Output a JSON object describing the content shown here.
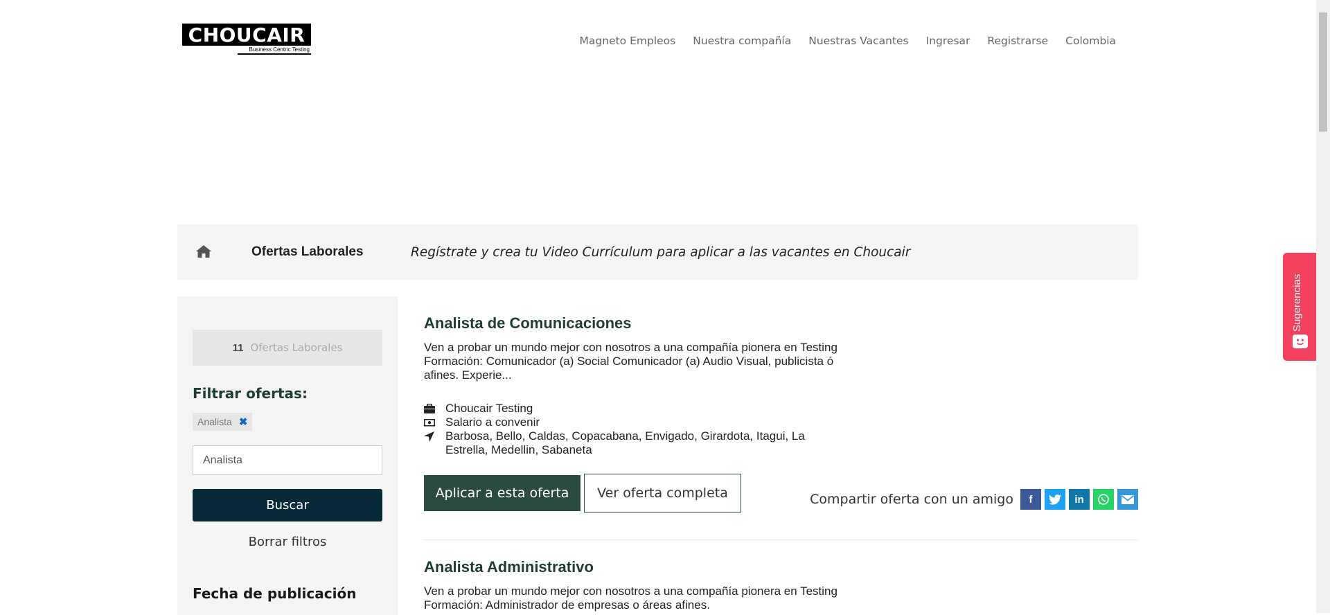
{
  "brand": {
    "name": "CHOUCAIR",
    "tagline": "Business Centric Testing"
  },
  "nav": {
    "items": [
      "Magneto Empleos",
      "Nuestra compañía",
      "Nuestras Vacantes",
      "Ingresar",
      "Registrarse",
      "Colombia"
    ]
  },
  "breadcrumb": {
    "title": "Ofertas Laborales",
    "slogan": "Regístrate y crea tu Video Currículum para aplicar a las vacantes en Choucair"
  },
  "sidebar": {
    "count": "11",
    "count_label": "Ofertas Laborales",
    "filter_title": "Filtrar ofertas:",
    "active_filter": "Analista",
    "search_value": "Analista",
    "search_placeholder": "Analista",
    "search_button": "Buscar",
    "clear_button": "Borrar filtros",
    "date_title": "Fecha de publicación"
  },
  "jobs": [
    {
      "title": "Analista de Comunicaciones",
      "description": "Ven a probar un mundo mejor con nosotros a una compañía pionera en Testing Formación: Comunicador (a) Social Comunicador (a) Audio Visual, publicista ó afines. Experie...",
      "company": "Choucair Testing",
      "salary": "Salario a convenir",
      "locations": "Barbosa, Bello, Caldas, Copacabana, Envigado, Girardota, Itagui, La Estrella, Medellin, Sabaneta",
      "apply_label": "Aplicar a esta oferta",
      "view_label": "Ver oferta completa",
      "share_label": "Compartir oferta con un amigo"
    },
    {
      "title": "Analista Administrativo",
      "description": "Ven a probar un mundo mejor con nosotros a una compañía pionera en Testing Formación: Administrador de empresas o áreas afines."
    }
  ],
  "feedback_tab": {
    "label": "Sugerencias"
  },
  "icons": {
    "home": "home-icon",
    "company": "briefcase-icon",
    "salary": "money-icon",
    "location": "location-arrow-icon",
    "remove": "close-icon",
    "social": [
      "facebook-icon",
      "twitter-icon",
      "linkedin-icon",
      "whatsapp-icon",
      "email-icon"
    ]
  },
  "colors": {
    "primary_dark": "#062a38",
    "accent_green": "#2b4a40",
    "title_green": "#1f3d33",
    "feedback_red": "#f2405d",
    "panel_bg": "#f5f5f5"
  }
}
